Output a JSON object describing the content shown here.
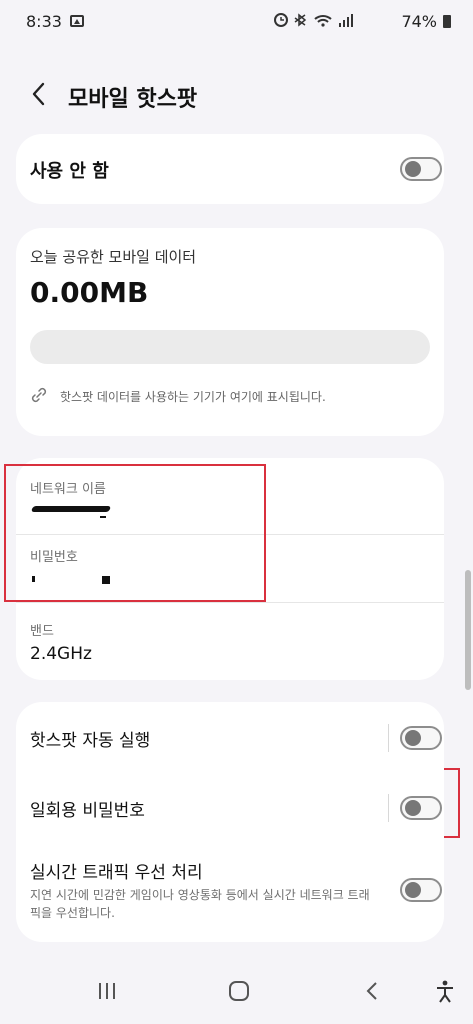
{
  "status_bar": {
    "time": "8:33",
    "battery": "74%",
    "icons": [
      "gallery-icon",
      "alarm-icon",
      "bluetooth-icon",
      "wifi-icon",
      "signal-icon",
      "battery-icon"
    ]
  },
  "header": {
    "title": "모바일 핫스팟"
  },
  "master_toggle": {
    "label": "사용 안 함",
    "state": "off"
  },
  "data_usage": {
    "label": "오늘 공유한 모바일 데이터",
    "amount": "0.00MB",
    "progress": 0,
    "note": "핫스팟 데이터를 사용하는 기기가 여기에 표시됩니다."
  },
  "network": {
    "name_label": "네트워크 이름",
    "password_label": "비밀번호",
    "band_label": "밴드",
    "band_value": "2.4GHz"
  },
  "settings": [
    {
      "label": "핫스팟 자동 실행",
      "state": "off"
    },
    {
      "label": "일회용 비밀번호",
      "state": "off"
    },
    {
      "label": "실시간 트래픽 우선 처리",
      "description": "지연 시간에 민감한 게임이나 영상통화 등에서 실시간 네트워크 트래픽을 우선합니다.",
      "state": "off"
    }
  ],
  "colors": {
    "highlight_box": "#d9303e",
    "background": "#f5f4f8"
  }
}
